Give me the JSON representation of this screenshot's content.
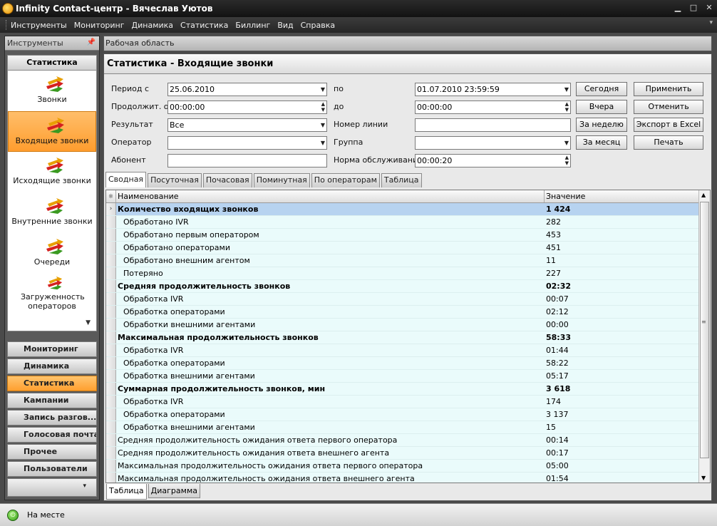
{
  "window": {
    "title": "Infinity Contact-центр  - Вячеслав Уютов"
  },
  "menu": [
    "Инструменты",
    "Мониторинг",
    "Динамика",
    "Статистика",
    "Биллинг",
    "Вид",
    "Справка"
  ],
  "left_panel": {
    "header": "Инструменты",
    "section": "Статистика",
    "items": [
      {
        "label": "Звонки"
      },
      {
        "label": "Входящие звонки"
      },
      {
        "label": "Исходящие звонки"
      },
      {
        "label": "Внутренние звонки"
      },
      {
        "label": "Очереди"
      },
      {
        "label": "Загруженность операторов"
      }
    ],
    "nav": [
      "Мониторинг",
      "Динамика",
      "Статистика",
      "Кампании",
      "Запись разгов...",
      "Голосовая почта",
      "Прочее",
      "Пользователи"
    ]
  },
  "work_area": {
    "header": "Рабочая область"
  },
  "page": {
    "title": "Статистика - Входящие звонки"
  },
  "filters": {
    "period_from_label": "Период с",
    "period_from": "25.06.2010",
    "period_to_label": "по",
    "period_to": "01.07.2010 23:59:59",
    "duration_from_label": "Продолжит. от",
    "duration_from": "00:00:00",
    "duration_to_label": "до",
    "duration_to": "00:00:00",
    "result_label": "Результат",
    "result": "Все",
    "line_label": "Номер линии",
    "line": "",
    "operator_label": "Оператор",
    "operator": "",
    "group_label": "Группа",
    "group": "",
    "subscriber_label": "Абонент",
    "subscriber": "",
    "norm_label": "Норма обслуживания",
    "norm": "00:00:20"
  },
  "buttons": {
    "today": "Сегодня",
    "yesterday": "Вчера",
    "week": "За неделю",
    "month": "За месяц",
    "apply": "Применить",
    "cancel": "Отменить",
    "export": "Экспорт в Excel",
    "print": "Печать"
  },
  "tabs": [
    "Сводная",
    "Посуточная",
    "Почасовая",
    "Поминутная",
    "По операторам",
    "Таблица"
  ],
  "grid": {
    "columns": [
      "Наименование",
      "Значение"
    ],
    "rows": [
      {
        "name": "Количество входящих звонков",
        "value": "1 424"
      },
      {
        "name": "Обработано IVR",
        "value": "282"
      },
      {
        "name": "Обработано первым оператором",
        "value": "453"
      },
      {
        "name": "Обработано операторами",
        "value": "451"
      },
      {
        "name": "Обработано внешним агентом",
        "value": "11"
      },
      {
        "name": "Потеряно",
        "value": "227"
      },
      {
        "name": "Средняя продолжительность звонков",
        "value": "02:32"
      },
      {
        "name": "Обработка IVR",
        "value": "00:07"
      },
      {
        "name": "Обработка операторами",
        "value": "02:12"
      },
      {
        "name": "Обработки внешними агентами",
        "value": "00:00"
      },
      {
        "name": "Максимальная продолжительность звонков",
        "value": "58:33"
      },
      {
        "name": "Обработка IVR",
        "value": "01:44"
      },
      {
        "name": "Обработка операторами",
        "value": "58:22"
      },
      {
        "name": "Обработка внешними агентами",
        "value": "05:17"
      },
      {
        "name": "Суммарная продолжительность звонков, мин",
        "value": "3 618"
      },
      {
        "name": "Обработка IVR",
        "value": "174"
      },
      {
        "name": "Обработка операторами",
        "value": "3 137"
      },
      {
        "name": "Обработка внешними агентами",
        "value": "15"
      },
      {
        "name": "Средняя продолжительность ожидания ответа первого оператора",
        "value": "00:14"
      },
      {
        "name": "Средняя продолжительность ожидания ответа внешнего агента",
        "value": "00:17"
      },
      {
        "name": "Максимальная продолжительность ожидания ответа первого оператора",
        "value": "05:00"
      },
      {
        "name": "Максимальная продолжительность ожидания ответа внешнего агента",
        "value": "01:54"
      }
    ]
  },
  "bottom_tabs": [
    "Таблица",
    "Диаграмма"
  ],
  "status": {
    "text": "На месте"
  }
}
